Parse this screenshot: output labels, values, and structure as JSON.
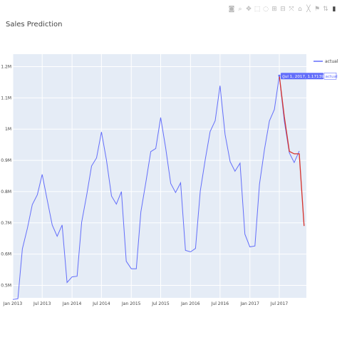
{
  "modebar": {
    "icons": [
      "camera-icon",
      "zoom-icon",
      "pan-icon",
      "box-select-icon",
      "lasso-select-icon",
      "zoom-in-icon",
      "zoom-out-icon",
      "autoscale-icon",
      "reset-axes-icon",
      "spike-lines-icon",
      "hover-closest-icon",
      "hover-compare-icon",
      "plotly-logo-icon"
    ],
    "glyphs": [
      "◙",
      "⌕",
      "✥",
      "⬚",
      "◌",
      "⊞",
      "⊟",
      "⤧",
      "⌂",
      "╳",
      "⚑",
      "⇅",
      "▮"
    ]
  },
  "chart_data": {
    "type": "line",
    "title": "Sales Prediction",
    "xlabel": "",
    "ylabel": "",
    "x_ticks": [
      "Jan 2013",
      "Jul 2013",
      "Jan 2014",
      "Jul 2014",
      "Jan 2015",
      "Jul 2015",
      "Jan 2016",
      "Jul 2016",
      "Jan 2017",
      "Jul 2017"
    ],
    "y_ticks": [
      "0.5M",
      "0.6M",
      "0.7M",
      "0.8M",
      "0.9M",
      "1M",
      "1.1M",
      "1.2M"
    ],
    "y_tick_values": [
      0.5,
      0.6,
      0.7,
      0.8,
      0.9,
      1.0,
      1.1,
      1.2
    ],
    "ylim": [
      0.46,
      1.24
    ],
    "xlim": [
      "2013-01-01",
      "2017-12-15"
    ],
    "grid": true,
    "legend": "top-right",
    "series": [
      {
        "name": "actual",
        "color": "#636efa",
        "x": [
          "2013-01",
          "2013-02",
          "2013-03",
          "2013-04",
          "2013-05",
          "2013-06",
          "2013-07",
          "2013-08",
          "2013-09",
          "2013-10",
          "2013-11",
          "2013-12",
          "2014-01",
          "2014-02",
          "2014-03",
          "2014-04",
          "2014-05",
          "2014-06",
          "2014-07",
          "2014-08",
          "2014-09",
          "2014-10",
          "2014-11",
          "2014-12",
          "2015-01",
          "2015-02",
          "2015-03",
          "2015-04",
          "2015-05",
          "2015-06",
          "2015-07",
          "2015-08",
          "2015-09",
          "2015-10",
          "2015-11",
          "2015-12",
          "2016-01",
          "2016-02",
          "2016-03",
          "2016-04",
          "2016-05",
          "2016-06",
          "2016-07",
          "2016-08",
          "2016-09",
          "2016-10",
          "2016-11",
          "2016-12",
          "2017-01",
          "2017-02",
          "2017-03",
          "2017-04",
          "2017-05",
          "2017-06",
          "2017-07",
          "2017-08",
          "2017-09",
          "2017-10",
          "2017-11",
          "2017-12"
        ],
        "y": [
          0.455,
          0.457,
          0.617,
          0.683,
          0.758,
          0.79,
          0.855,
          0.773,
          0.693,
          0.657,
          0.693,
          0.509,
          0.527,
          0.529,
          0.702,
          0.788,
          0.882,
          0.908,
          0.991,
          0.901,
          0.786,
          0.76,
          0.8,
          0.577,
          0.553,
          0.553,
          0.735,
          0.831,
          0.928,
          0.938,
          1.037,
          0.94,
          0.826,
          0.797,
          0.828,
          0.612,
          0.607,
          0.618,
          0.802,
          0.903,
          0.992,
          1.027,
          1.139,
          0.983,
          0.896,
          0.865,
          0.891,
          0.664,
          0.623,
          0.626,
          0.824,
          0.935,
          1.026,
          1.063,
          1.171,
          1.026,
          0.924,
          0.893,
          0.93,
          null
        ]
      },
      {
        "name": "",
        "color": "#d6312b",
        "x": [
          "2017-07",
          "2017-08",
          "2017-09",
          "2017-10",
          "2017-11",
          "2017-12"
        ],
        "y": [
          1.171,
          1.04,
          0.929,
          0.921,
          0.921,
          0.69
        ]
      }
    ],
    "hover": {
      "text": "(Jul 1, 2017, 1.171393M)",
      "series": "actual",
      "x": "2017-07",
      "y": 1.171
    }
  }
}
